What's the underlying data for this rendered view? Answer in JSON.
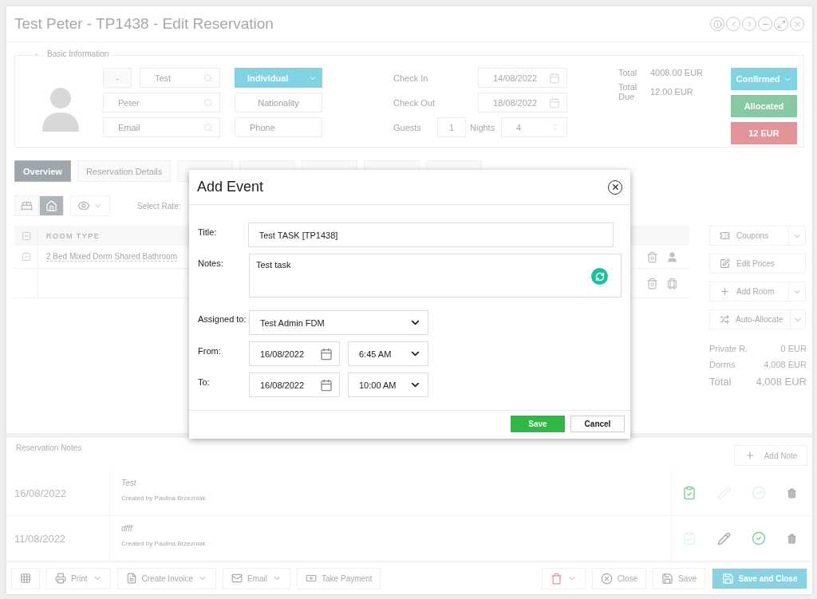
{
  "window": {
    "title": "Test Peter - TP1438 - Edit Reservation"
  },
  "basic_info": {
    "legend": "Basic Information",
    "salutation": "-",
    "first_name": "Test",
    "last_name": "Peter",
    "email": {
      "placeholder": "Email"
    },
    "guest_type": "Individual",
    "nationality": {
      "placeholder": "Nationality"
    },
    "phone": {
      "placeholder": "Phone"
    },
    "check_in_label": "Check In",
    "check_in": "14/08/2022",
    "check_out_label": "Check Out",
    "check_out": "18/08/2022",
    "guests_label": "Guests",
    "guests": "1",
    "nights_label": "Nights",
    "nights": "4",
    "totals": [
      {
        "label": "Total",
        "value": "4008.00 EUR"
      },
      {
        "label": "Total Due",
        "value": "12.00 EUR"
      }
    ],
    "status_buttons": [
      {
        "label": "Confirmed",
        "dropdown": true,
        "color": "#7fd3e2"
      },
      {
        "label": "Allocated",
        "dropdown": false,
        "color": "#86c9a2"
      },
      {
        "label": "12 EUR",
        "dropdown": false,
        "color": "#e3939a"
      }
    ]
  },
  "tabs": [
    {
      "label": "Overview",
      "selected": true
    },
    {
      "label": "Reservation Details",
      "selected": false
    },
    {
      "selected": false
    },
    {
      "selected": false
    },
    {
      "selected": false
    },
    {
      "selected": false
    },
    {
      "selected": false
    }
  ],
  "toolbar": {
    "views": [
      {
        "kind": "bed",
        "selected": false
      },
      {
        "kind": "home",
        "selected": true
      }
    ],
    "select_rate_label": "Select Rate:"
  },
  "rooms_table": {
    "column": "ROOM TYPE",
    "rows": [
      {
        "kind": "room",
        "room_type": "2 Bed Mixed Dorm Shared Bathroom"
      },
      {
        "kind": "empty"
      }
    ]
  },
  "actions": [
    {
      "label": "Coupons",
      "kind": "ticket",
      "dropdown": true
    },
    {
      "label": "Edit Prices",
      "kind": "edit",
      "dropdown": false
    },
    {
      "label": "Add Room",
      "kind": "plus",
      "dropdown": true
    },
    {
      "label": "Auto-Allocate",
      "kind": "shuffle",
      "dropdown": true
    }
  ],
  "summary": [
    {
      "label": "Private R.",
      "value": "0 EUR",
      "kind": "line"
    },
    {
      "label": "Dorms",
      "value": "4,008 EUR",
      "kind": "line"
    },
    {
      "label": "Total",
      "value": "4,008 EUR",
      "kind": "total"
    }
  ],
  "notes": {
    "title": "Reservation Notes",
    "add_button": "Add Note",
    "items": [
      {
        "date": "16/08/2022",
        "text": "Test",
        "author": "Created by Paulina Brzezniak",
        "pinned": true,
        "editable": false,
        "done": false
      },
      {
        "date": "11/08/2022",
        "text": "dfff",
        "author": "Created by Paulina Brzezniak",
        "pinned": false,
        "editable": true,
        "done": true
      }
    ]
  },
  "footer": {
    "left": [
      {
        "kind": "grid"
      },
      {
        "kind": "print",
        "label": "Print",
        "dropdown": true
      },
      {
        "kind": "invoice",
        "label": "Create Invoice",
        "dropdown": true
      },
      {
        "kind": "email",
        "label": "Email",
        "dropdown": true
      },
      {
        "kind": "payment",
        "label": "Take Payment",
        "dropdown": false
      }
    ],
    "right": [
      {
        "kind": "delete",
        "dropdown": true
      },
      {
        "kind": "close",
        "label": "Close",
        "dropdown": false
      },
      {
        "kind": "save",
        "label": "Save",
        "dropdown": false
      },
      {
        "kind": "save_close",
        "label": "Save and Close",
        "dropdown": false
      }
    ]
  },
  "dialog": {
    "title": "Add Event",
    "title_label": "Title:",
    "title_value": "Test TASK [TP1438]",
    "notes_label": "Notes:",
    "notes_value": "Test task",
    "assigned_label": "Assigned to:",
    "assigned_value": "Test Admin FDM",
    "from_label": "From:",
    "from_date": "16/08/2022",
    "from_time": "6:45 AM",
    "to_label": "To:",
    "to_date": "16/08/2022",
    "to_time": "10:00 AM",
    "buttons": [
      {
        "label": "Save",
        "kind": "primary"
      },
      {
        "label": "Cancel",
        "kind": "secondary"
      }
    ]
  }
}
